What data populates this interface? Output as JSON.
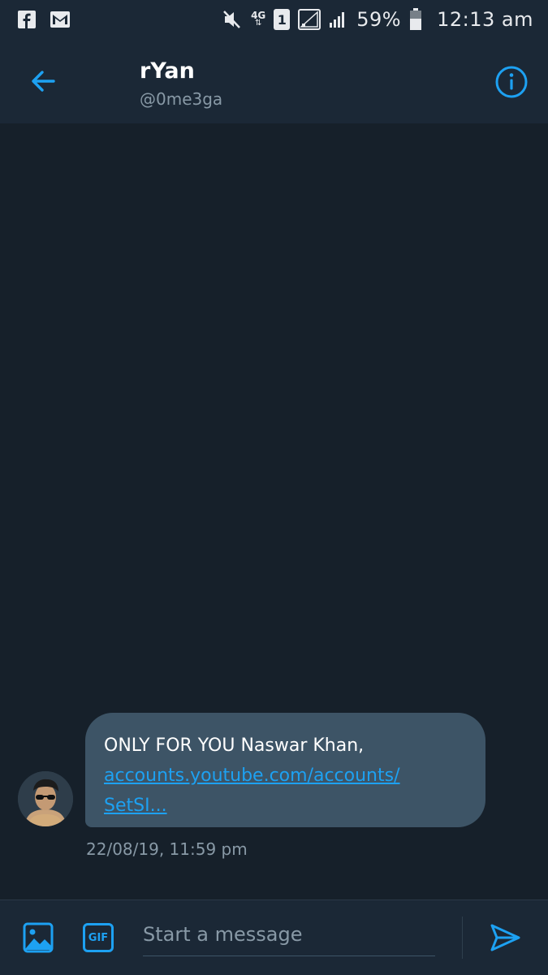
{
  "status_bar": {
    "left_icons": [
      "facebook-icon",
      "gmail-icon"
    ],
    "network": "4G",
    "sim": "1",
    "battery": "59%",
    "time": "12:13 am"
  },
  "header": {
    "title": "rYan",
    "handle": "@0me3ga",
    "back_icon": "arrow-left-icon",
    "info_icon": "info-circle-icon"
  },
  "messages": [
    {
      "text": "ONLY FOR YOU Naswar Khan,",
      "link": "accounts.youtube.com/accounts/SetSI...",
      "link_line1": "accounts.youtube.com/accounts/",
      "link_line2": "SetSI...",
      "timestamp": "22/08/19, 11:59 pm"
    }
  ],
  "composer": {
    "placeholder": "Start a message",
    "gif_label": "GIF",
    "media_icon": "image-icon",
    "send_icon": "send-icon"
  },
  "colors": {
    "accent": "#1da1f2",
    "background": "#16202a",
    "header_bg": "#1b2836",
    "bubble_bg": "#3d5466",
    "secondary_text": "#8899a6"
  }
}
